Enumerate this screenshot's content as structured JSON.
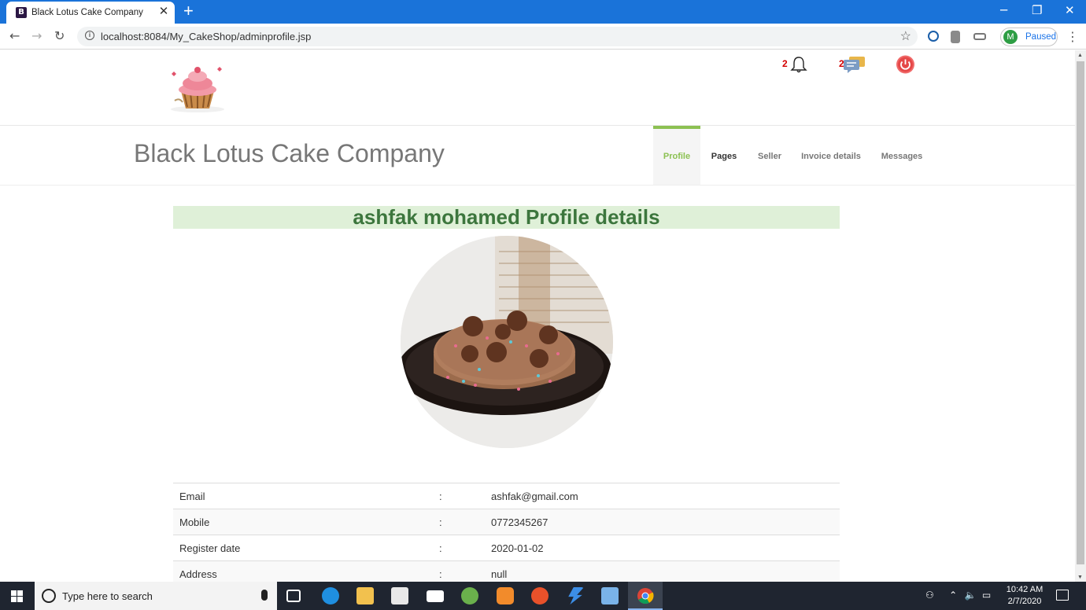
{
  "browser": {
    "tab_title": "Black Lotus Cake Company",
    "tab_favicon": "B",
    "tab_close": "✕",
    "new_tab": "+",
    "url": "localhost:8084/My_CakeShop/adminprofile.jsp",
    "profile_initial": "M",
    "profile_status": "Paused",
    "minimize": "─",
    "restore": "❐",
    "close": "✕"
  },
  "header": {
    "notification_count": "2",
    "message_count": "2"
  },
  "nav": {
    "brand": "Black Lotus Cake Company",
    "items": [
      {
        "label": "Profile"
      },
      {
        "label": "Pages"
      },
      {
        "label": "Seller"
      },
      {
        "label": "Invoice details"
      },
      {
        "label": "Messages"
      }
    ]
  },
  "profile": {
    "heading": "ashfak mohamed Profile details",
    "fields": [
      {
        "label": "Email",
        "sep": ":",
        "value": "ashfak@gmail.com"
      },
      {
        "label": "Mobile",
        "sep": ":",
        "value": "0772345267"
      },
      {
        "label": "Register date",
        "sep": ":",
        "value": "2020-01-02"
      },
      {
        "label": "Address",
        "sep": ":",
        "value": "null"
      }
    ]
  },
  "taskbar": {
    "search_placeholder": "Type here to search",
    "time": "10:42 AM",
    "date": "2/7/2020"
  },
  "colors": {
    "chrome_blue": "#1a73d9",
    "nav_active": "#8cc152",
    "heading_bg": "#dff0d8",
    "heading_text": "#3c763d",
    "notif_red": "#d40000"
  }
}
